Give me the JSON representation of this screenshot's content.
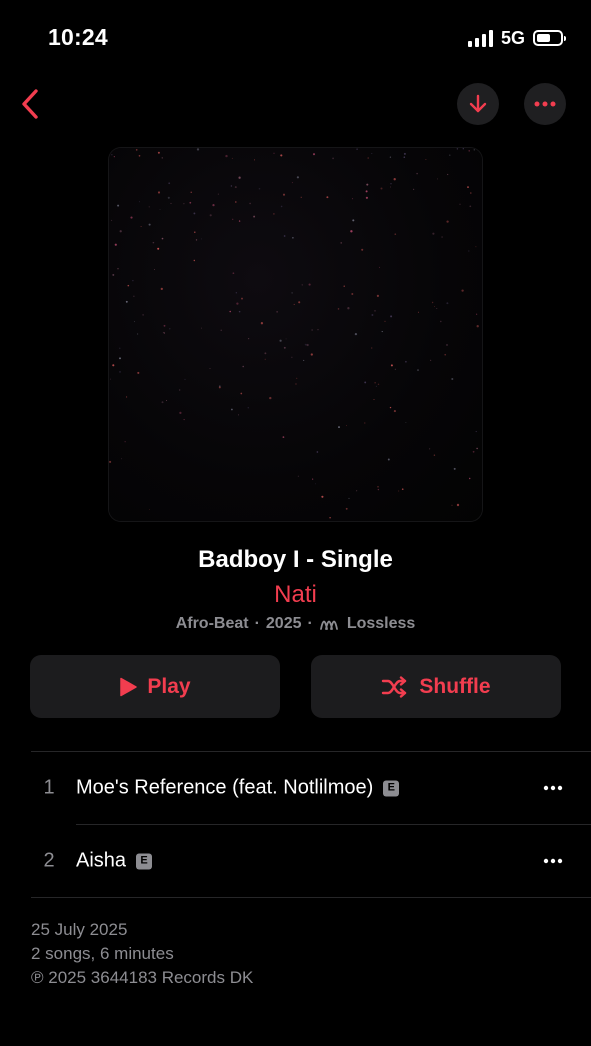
{
  "status_bar": {
    "time": "10:24",
    "network": "5G"
  },
  "icons": {
    "back": "chevron-left-icon",
    "download": "arrow-down-icon",
    "more": "ellipsis-icon",
    "play": "play-icon",
    "shuffle": "shuffle-icon",
    "lossless": "lossless-icon",
    "explicit": "explicit-icon"
  },
  "colors": {
    "accent": "#f23d4f",
    "background": "#000000",
    "button_bg": "#1c1c1e",
    "secondary_text": "#8d8d92"
  },
  "album": {
    "title": "Badboy I - Single",
    "artist": "Nati",
    "genre": "Afro-Beat",
    "year": "2025",
    "quality": "Lossless"
  },
  "actions": {
    "play_label": "Play",
    "shuffle_label": "Shuffle"
  },
  "tracks": [
    {
      "number": "1",
      "title": "Moe's Reference (feat. Notlilmoe)",
      "explicit_badge": "E"
    },
    {
      "number": "2",
      "title": "Aisha",
      "explicit_badge": "E"
    }
  ],
  "footer": {
    "release_date": "25 July 2025",
    "summary": "2 songs, 6 minutes",
    "copyright": "℗ 2025 3644183 Records DK"
  }
}
